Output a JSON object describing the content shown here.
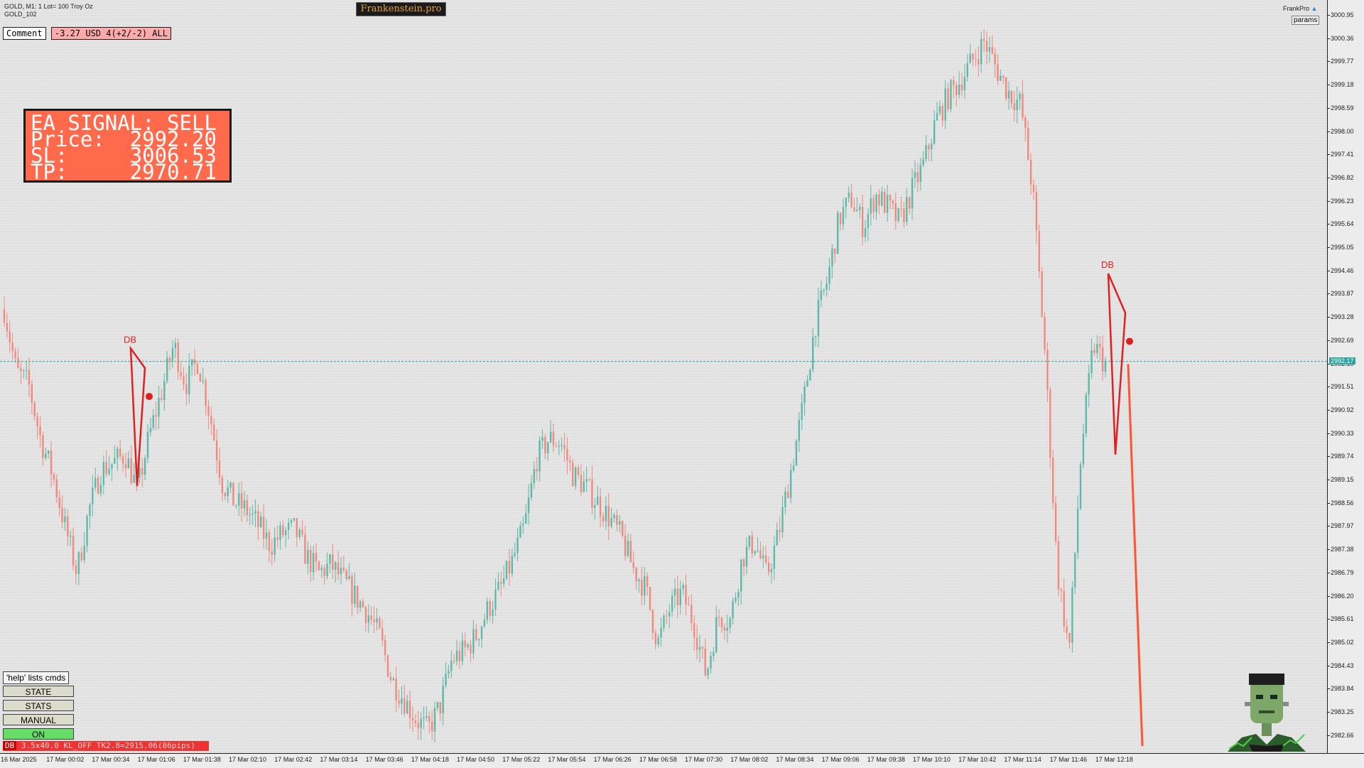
{
  "header": {
    "symbol_line": "GOLD, M1:  1 Lot= 100 Troy Oz",
    "account": "GOLD_102",
    "brand": "Frankenstein.pro",
    "frankpro": "FrankPro",
    "params": "params"
  },
  "toolbar": {
    "comment": "Comment",
    "pnl": "-3.27 USD 4(+2/-2) ALL"
  },
  "signal": {
    "line1": "EA SIGNAL: SELL",
    "line2": "Price:  2992.20",
    "line3": "SL:     3006.53",
    "line4": "TP:     2970.71"
  },
  "controls": {
    "help": "'help' lists cmds",
    "state": "STATE",
    "stats": "STATS",
    "manual": "MANUAL",
    "on": "ON"
  },
  "status": {
    "tag": "DB",
    "text": " 3.5x40.0 KL_OFF TK2.8=2915.06(86pips)"
  },
  "colors": {
    "bull": "#5fb8a8",
    "bear": "#ef8a7f",
    "line": "#e02020",
    "bid": "#2aa5a0"
  },
  "chart_data": {
    "type": "candlestick",
    "price_ticks": [
      "3000.95",
      "3000.36",
      "2999.77",
      "2999.18",
      "2998.59",
      "2998.00",
      "2997.41",
      "2996.82",
      "2996.23",
      "2995.64",
      "2995.05",
      "2994.46",
      "2993.87",
      "2993.28",
      "2992.69",
      "2992.10",
      "2991.51",
      "2990.92",
      "2990.33",
      "2989.74",
      "2989.15",
      "2988.56",
      "2987.97",
      "2987.38",
      "2986.79",
      "2986.20",
      "2985.61",
      "2985.02",
      "2984.43",
      "2983.84",
      "2983.25",
      "2982.66"
    ],
    "bid_price": "2992.17",
    "time_ticks": [
      "16 Mar 2025",
      "17 Mar 00:02",
      "17 Mar 00:34",
      "17 Mar 01:06",
      "17 Mar 01:38",
      "17 Mar 02:10",
      "17 Mar 02:42",
      "17 Mar 03:14",
      "17 Mar 03:46",
      "17 Mar 04:18",
      "17 Mar 04:50",
      "17 Mar 05:22",
      "17 Mar 05:54",
      "17 Mar 06:26",
      "17 Mar 06:58",
      "17 Mar 07:30",
      "17 Mar 08:02",
      "17 Mar 08:34",
      "17 Mar 09:06",
      "17 Mar 09:38",
      "17 Mar 10:10",
      "17 Mar 10:42",
      "17 Mar 11:14",
      "17 Mar 11:46",
      "17 Mar 12:18"
    ],
    "anchor_prices": [
      2993.5,
      2991.9,
      2991.6,
      2990.2,
      2989.3,
      2988.0,
      2986.8,
      2988.4,
      2989.4,
      2989.6,
      2989.8,
      2988.9,
      2990.3,
      2991.4,
      2992.6,
      2991.6,
      2992.2,
      2990.8,
      2989.1,
      2988.6,
      2988.4,
      2988.0,
      2987.5,
      2987.8,
      2987.9,
      2987.2,
      2986.8,
      2987.0,
      2986.6,
      2986.2,
      2985.8,
      2985.2,
      2984.1,
      2983.6,
      2983.1,
      2982.8,
      2983.4,
      2984.6,
      2984.8,
      2985.2,
      2985.9,
      2986.4,
      2987.1,
      2988.0,
      2989.7,
      2990.2,
      2990.1,
      2989.3,
      2989.0,
      2988.6,
      2988.2,
      2987.7,
      2986.9,
      2986.4,
      2985.0,
      2985.9,
      2986.3,
      2985.5,
      2984.2,
      2985.7,
      2985.6,
      2987.2,
      2987.6,
      2986.7,
      2987.8,
      2989.4,
      2991.0,
      2993.1,
      2994.2,
      2995.8,
      2996.3,
      2995.6,
      2996.4,
      2996.1,
      2995.7,
      2996.5,
      2997.2,
      2998.3,
      2998.9,
      2999.3,
      2999.8,
      3000.3,
      2999.6,
      2999.0,
      2998.7,
      2996.5,
      2992.4,
      2986.9,
      2984.8,
      2989.9,
      2992.6,
      2992.1
    ],
    "annotations": [
      {
        "label": "DB",
        "points": [
          [
            2992.5,
            1
          ],
          [
            2989.0,
            1
          ],
          [
            2992.0,
            1
          ]
        ]
      },
      {
        "label": "DB",
        "points": [
          [
            2994.4,
            1
          ],
          [
            2989.8,
            1
          ],
          [
            2993.4,
            1
          ]
        ]
      }
    ],
    "projection": {
      "from": 2992.1,
      "to": 2982.4
    }
  }
}
